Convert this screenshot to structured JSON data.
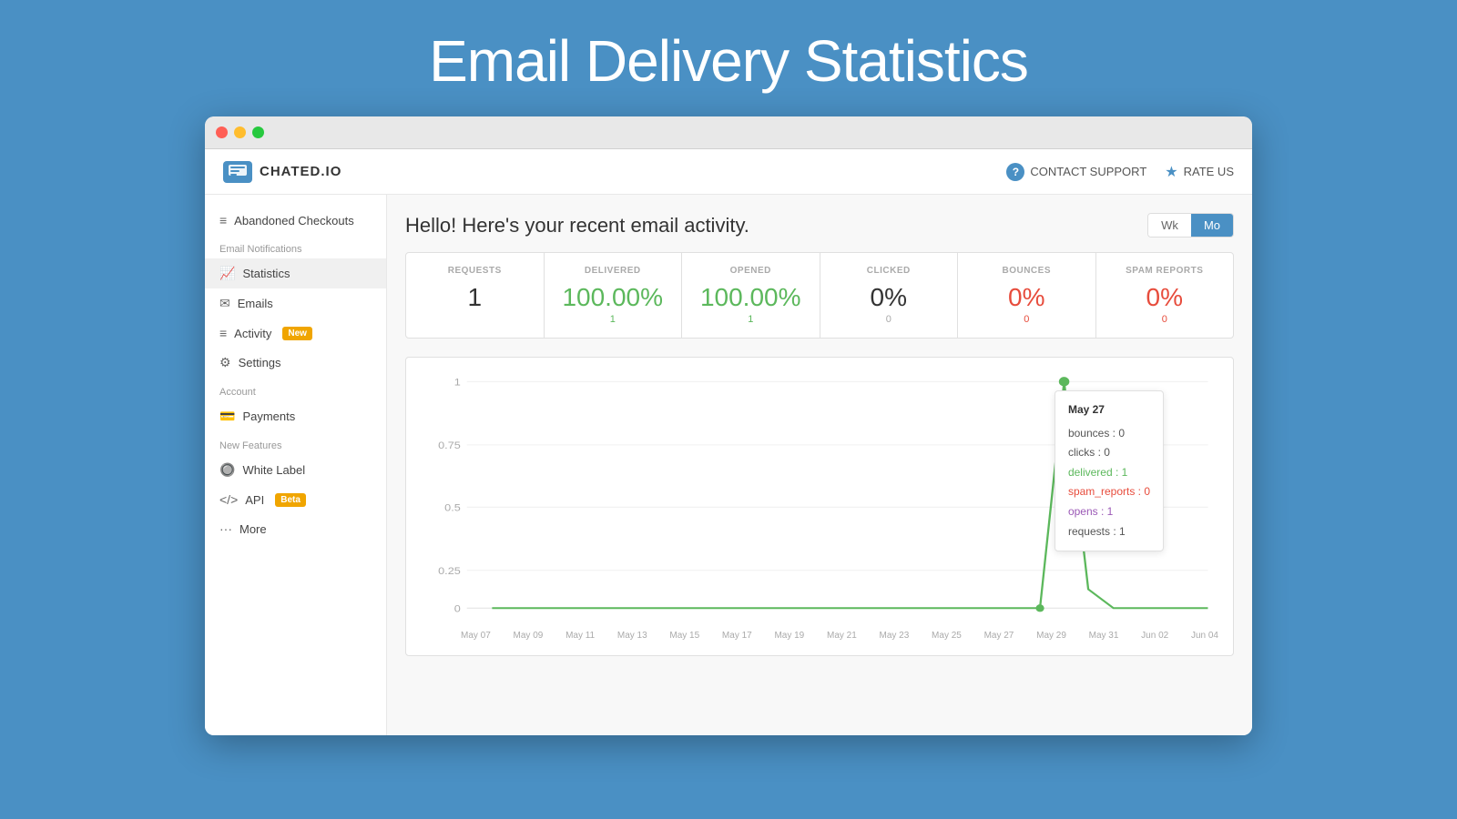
{
  "page": {
    "title": "Email Delivery Statistics"
  },
  "topbar": {
    "logo_text": "CHATED.IO",
    "contact_support_label": "CONTACT SUPPORT",
    "rate_us_label": "RATE US"
  },
  "sidebar": {
    "top_item": "Abandoned Checkouts",
    "section_email": "Email Notifications",
    "items": [
      {
        "id": "statistics",
        "label": "Statistics",
        "icon": "📈",
        "active": true
      },
      {
        "id": "emails",
        "label": "Emails",
        "icon": "✉️"
      },
      {
        "id": "activity",
        "label": "Activity",
        "icon": "≡",
        "badge": "New"
      },
      {
        "id": "settings",
        "label": "Settings",
        "icon": "⚙️"
      }
    ],
    "section_account": "Account",
    "account_items": [
      {
        "id": "payments",
        "label": "Payments",
        "icon": "💳"
      }
    ],
    "section_new_features": "New Features",
    "feature_items": [
      {
        "id": "white-label",
        "label": "White Label",
        "icon": "🔘"
      },
      {
        "id": "api",
        "label": "API",
        "icon": "</>",
        "badge": "Beta"
      }
    ],
    "more_label": "More"
  },
  "content": {
    "header": "Hello! Here's your recent email activity.",
    "toggle_wk": "Wk",
    "toggle_mo": "Mo",
    "stats": [
      {
        "id": "requests",
        "label": "REQUESTS",
        "value": "1",
        "sub": "",
        "color": "neutral"
      },
      {
        "id": "delivered",
        "label": "DELIVERED",
        "value": "100.00%",
        "sub": "1",
        "color": "green"
      },
      {
        "id": "opened",
        "label": "OPENED",
        "value": "100.00%",
        "sub": "1",
        "color": "green"
      },
      {
        "id": "clicked",
        "label": "CLICKED",
        "value": "0%",
        "sub": "0",
        "color": "neutral"
      },
      {
        "id": "bounces",
        "label": "BOUNCES",
        "value": "0%",
        "sub": "0",
        "color": "red"
      },
      {
        "id": "spam_reports",
        "label": "SPAM REPORTS",
        "value": "0%",
        "sub": "0",
        "color": "red"
      }
    ],
    "chart": {
      "x_labels": [
        "May 07",
        "May 09",
        "May 11",
        "May 13",
        "May 15",
        "May 17",
        "May 19",
        "May 21",
        "May 23",
        "May 25",
        "May 27",
        "May 29",
        "May 31",
        "Jun 02",
        "Jun 04"
      ],
      "y_labels": [
        "0",
        "0.25",
        "0.5",
        "0.75",
        "1"
      ]
    },
    "tooltip": {
      "date": "May 27",
      "rows": [
        {
          "label": "bounces",
          "value": "0",
          "color": "normal"
        },
        {
          "label": "clicks",
          "value": "0",
          "color": "normal"
        },
        {
          "label": "delivered",
          "value": "1",
          "color": "delivered"
        },
        {
          "label": "spam_reports",
          "value": "0",
          "color": "spam"
        },
        {
          "label": "opens",
          "value": "1",
          "color": "opens"
        },
        {
          "label": "requests",
          "value": "1",
          "color": "normal"
        }
      ]
    }
  }
}
